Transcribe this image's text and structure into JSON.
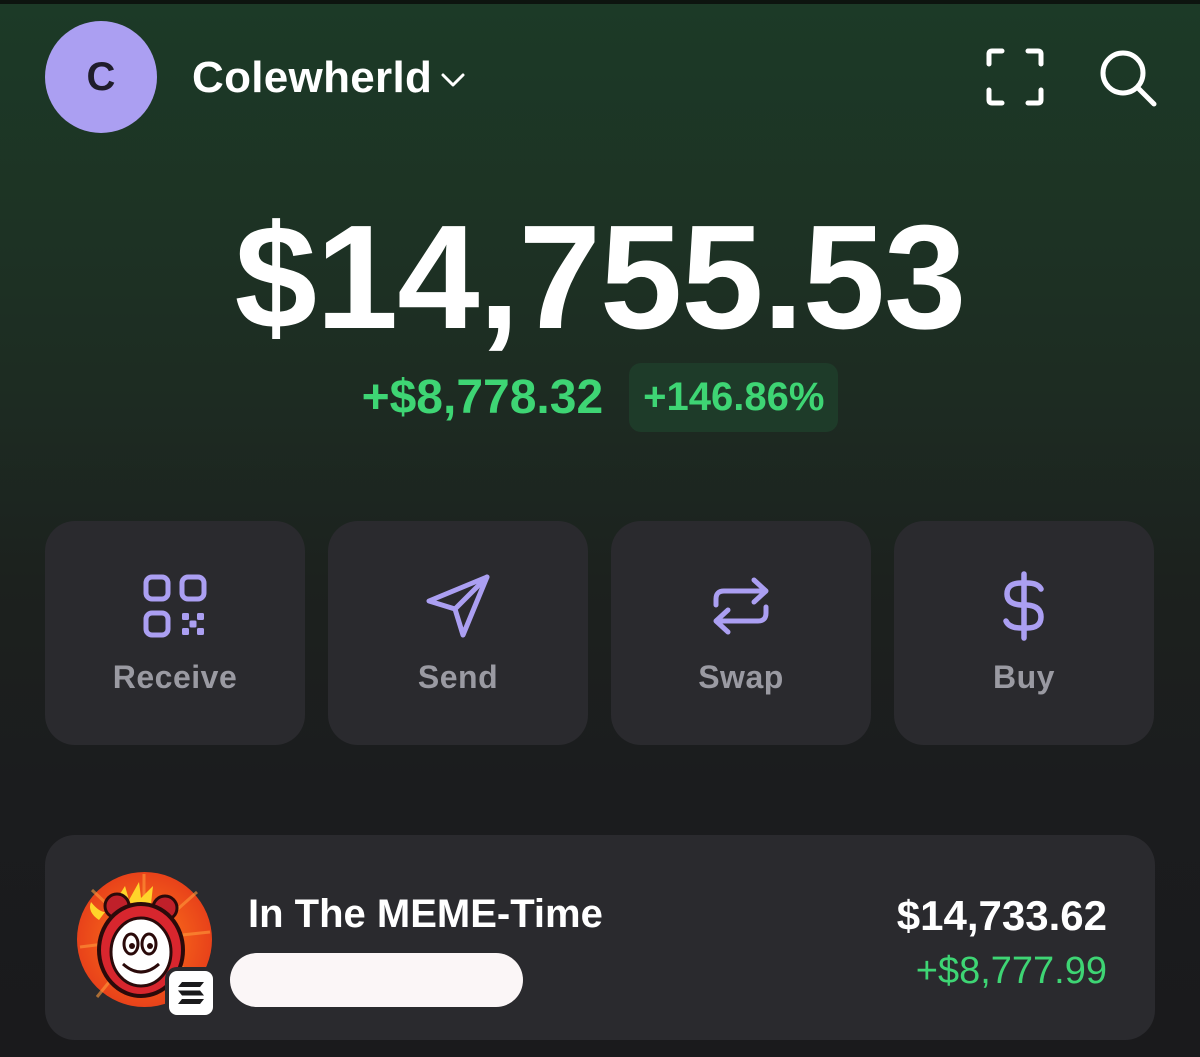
{
  "header": {
    "avatar_letter": "C",
    "account_name": "Colewherld",
    "icons": [
      "chevron-down-icon",
      "scan-icon",
      "search-icon"
    ]
  },
  "portfolio": {
    "balance": "$14,755.53",
    "change_value": "+$8,778.32",
    "change_percent": "+146.86%"
  },
  "actions": [
    {
      "label": "Receive",
      "icon": "qr-code-icon"
    },
    {
      "label": "Send",
      "icon": "send-icon"
    },
    {
      "label": "Swap",
      "icon": "swap-icon"
    },
    {
      "label": "Buy",
      "icon": "dollar-icon"
    }
  ],
  "tokens": [
    {
      "name": "In The MEME-Time",
      "value": "$14,733.62",
      "change": "+$8,777.99",
      "icon": "meme-time-token-icon",
      "chain_icon": "solana-icon"
    }
  ],
  "colors": {
    "accent": "#ab9ff2",
    "positive": "#3ed574",
    "card": "#2a2a2e",
    "label": "#9a9aa2"
  }
}
